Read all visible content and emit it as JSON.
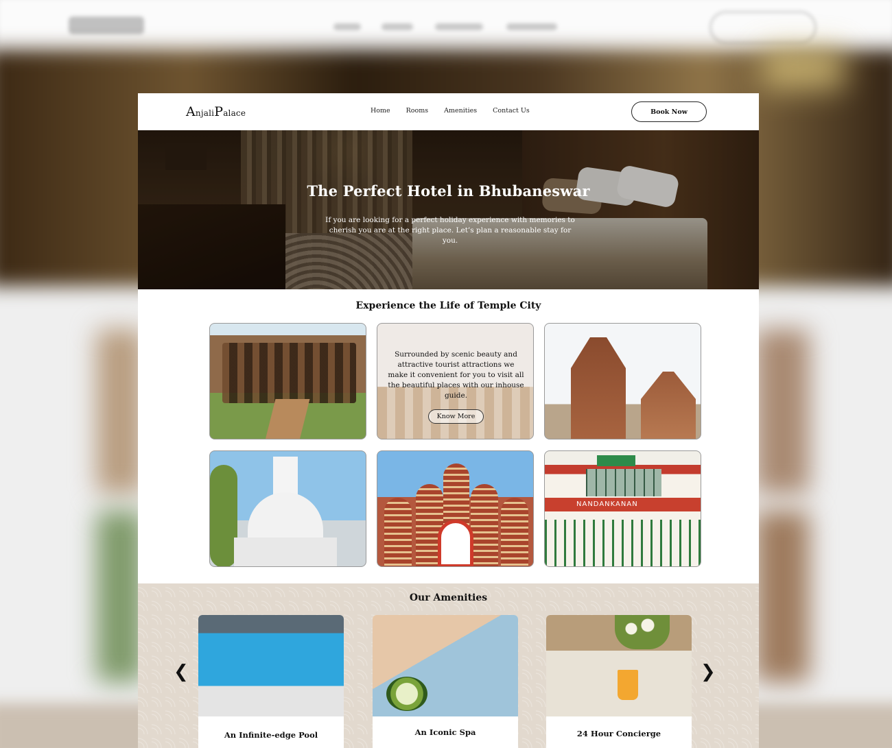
{
  "brand": {
    "logo_first_initial": "A",
    "logo_first_rest": "njali",
    "logo_second_initial": "P",
    "logo_second_rest": "alace"
  },
  "nav": {
    "items": [
      "Home",
      "Rooms",
      "Amenities",
      "Contact Us"
    ],
    "cta": "Book Now"
  },
  "hero": {
    "title": "The Perfect Hotel in Bhubaneswar",
    "subtitle": "If you are looking for a perfect holiday experience with memories to cherish you are at the right place. Let’s plan a reasonable stay for you."
  },
  "temple_city": {
    "title": "Experience the Life of Temple City",
    "blurb": "Surrounded by scenic beauty and attractive tourist attractions we make it convenient for you to visit all the beautiful places with our inhouse guide.",
    "button": "Know More",
    "sign_text": "NANDANKANAN"
  },
  "amenities": {
    "title": "Our Amenities",
    "prev_icon": "chevron-left-icon",
    "next_icon": "chevron-right-icon",
    "prev_glyph": "❮",
    "next_glyph": "❯",
    "cards": [
      {
        "label": "An Infinite-edge Pool"
      },
      {
        "label": "An Iconic Spa"
      },
      {
        "label": "24 Hour Concierge"
      }
    ]
  },
  "colors": {
    "amenities_bg": "#e2d9ce",
    "text": "#111111",
    "page_bg": "#ffffff"
  }
}
